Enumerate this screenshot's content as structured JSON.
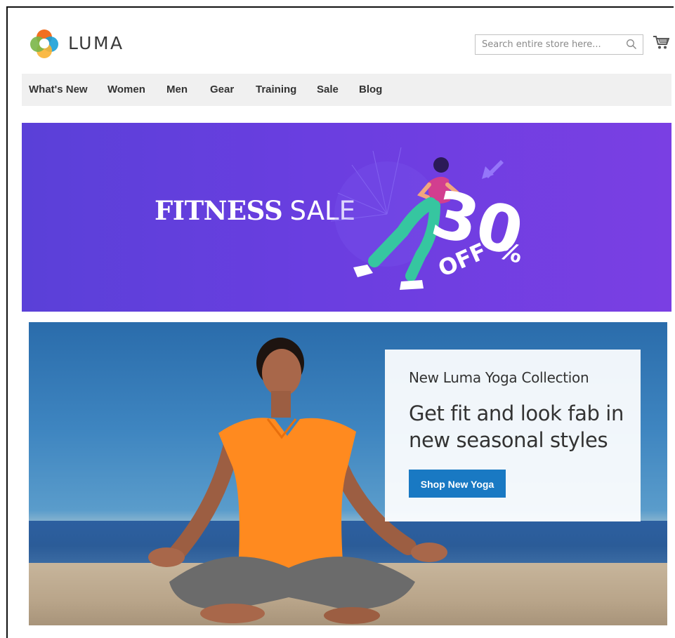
{
  "header": {
    "logo_text": "LUMA",
    "search_placeholder": "Search entire store here...",
    "icons": {
      "search": "search-icon",
      "cart": "cart-icon",
      "logo": "luma-logo-icon"
    }
  },
  "nav": {
    "items": [
      "What's New",
      "Women",
      "Men",
      "Gear",
      "Training",
      "Sale",
      "Blog"
    ]
  },
  "banner": {
    "title_bold": "FITNESS",
    "title_light": "SALE",
    "discount": "30",
    "percent": "%",
    "off": "OFF"
  },
  "promo": {
    "kicker": "New Luma Yoga Collection",
    "headline_line1": "Get fit and look fab in",
    "headline_line2": "new seasonal styles",
    "button_label": "Shop New Yoga",
    "accent_color": "#1979c3"
  },
  "colors": {
    "banner_purple": "#6a3ee0",
    "nav_background": "#f0f0f0",
    "button_blue": "#1979c3"
  }
}
